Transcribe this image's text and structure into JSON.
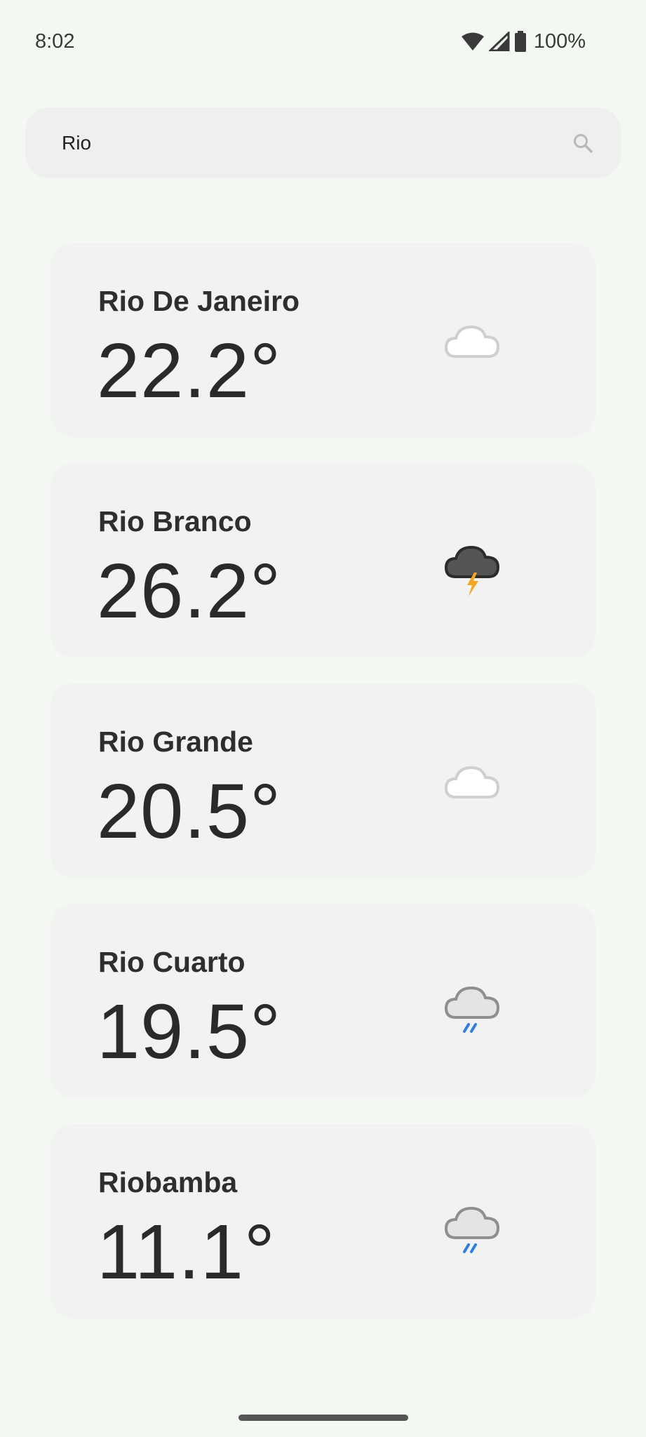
{
  "status_bar": {
    "time": "8:02",
    "battery": "100%",
    "icons": [
      "wifi-icon",
      "signal-icon",
      "battery-icon"
    ]
  },
  "search": {
    "value": "Rio",
    "icon": "search-icon"
  },
  "results": [
    {
      "city": "Rio De Janeiro",
      "temp": "22.2°",
      "icon": "moon-cloud-icon"
    },
    {
      "city": "Rio Branco",
      "temp": "26.2°",
      "icon": "moon-thunderstorm-icon"
    },
    {
      "city": "Rio Grande",
      "temp": "20.5°",
      "icon": "moon-cloud-icon"
    },
    {
      "city": "Rio Cuarto",
      "temp": "19.5°",
      "icon": "moon-rain-icon"
    },
    {
      "city": "Riobamba",
      "temp": "11.1°",
      "icon": "moon-rain-icon"
    }
  ],
  "colors": {
    "background": "#f4f8f3",
    "card": "#f2f2f2",
    "moon": "#1a6fd6",
    "lightning": "#f5a623",
    "rain": "#2f7fe0"
  }
}
